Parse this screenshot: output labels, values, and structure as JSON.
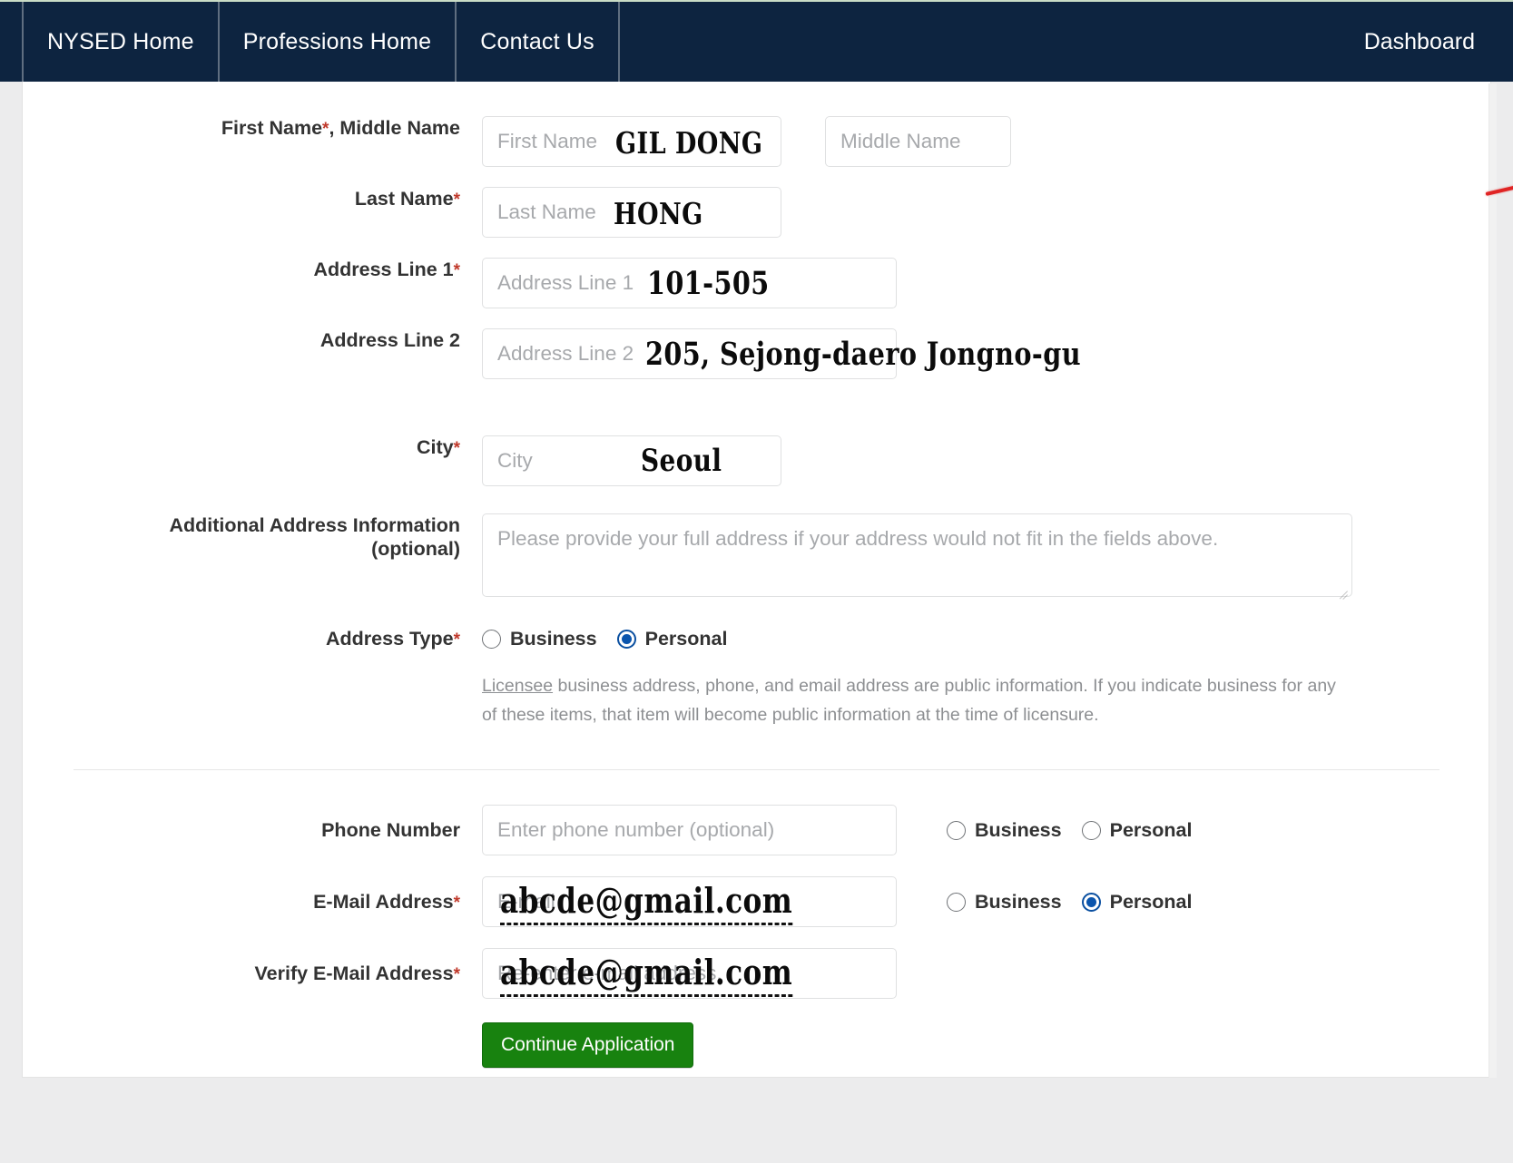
{
  "nav": {
    "items": [
      {
        "label": "NYSED Home",
        "name": "nav-nysed-home"
      },
      {
        "label": "Professions Home",
        "name": "nav-professions-home"
      },
      {
        "label": "Contact Us",
        "name": "nav-contact-us"
      }
    ],
    "dashboard_label": "Dashboard"
  },
  "form": {
    "first_name": {
      "label": "First Name",
      "required_mark": "*",
      "label_suffix": ", Middle Name",
      "placeholder": "First Name",
      "value": "GIL DONG"
    },
    "middle_name": {
      "placeholder": "Middle Name",
      "value": ""
    },
    "last_name": {
      "label": "Last Name",
      "required_mark": "*",
      "placeholder": "Last Name",
      "value": "HONG"
    },
    "address_line_1": {
      "label": "Address Line 1",
      "required_mark": "*",
      "placeholder": "Address Line 1",
      "value": "101-505"
    },
    "address_line_2": {
      "label": "Address Line 2",
      "placeholder": "Address Line 2",
      "value": "205, Sejong-daero Jongno-gu"
    },
    "city": {
      "label": "City",
      "required_mark": "*",
      "placeholder": "City",
      "value": "Seoul"
    },
    "additional_address": {
      "label_line_1": "Additional Address Information",
      "label_line_2": "(optional)",
      "placeholder": "Please provide your full address if your address would not fit in the fields above.",
      "value": ""
    },
    "address_type": {
      "label": "Address Type",
      "required_mark": "*",
      "options": [
        {
          "label": "Business",
          "selected": false
        },
        {
          "label": "Personal",
          "selected": true
        }
      ]
    },
    "licensee_notice": {
      "link_text": "Licensee",
      "rest_line_1": " business address, phone, and email address are public information. If you indicate business for",
      "line_2": "any of these items, that item will become public information at the time of licensure."
    },
    "phone": {
      "label": "Phone Number",
      "placeholder": "Enter phone number (optional)",
      "value": "",
      "options": [
        {
          "label": "Business",
          "selected": false
        },
        {
          "label": "Personal",
          "selected": false
        }
      ]
    },
    "email": {
      "label": "E-Mail Address",
      "required_mark": "*",
      "placeholder": "E-mail",
      "value": "abcde@gmail.com",
      "options": [
        {
          "label": "Business",
          "selected": false
        },
        {
          "label": "Personal",
          "selected": true
        }
      ]
    },
    "verify_email": {
      "label": "Verify E-Mail Address",
      "required_mark": "*",
      "placeholder": "Re-enter e-mail address.",
      "value": "abcde@gmail.com"
    },
    "submit": {
      "label": "Continue Application"
    }
  },
  "colors": {
    "nav_background": "#0d2440",
    "required_star": "#c0392b",
    "radio_selected": "#0b55ad",
    "submit_button": "#18820f",
    "annotation_red": "#e02424"
  }
}
